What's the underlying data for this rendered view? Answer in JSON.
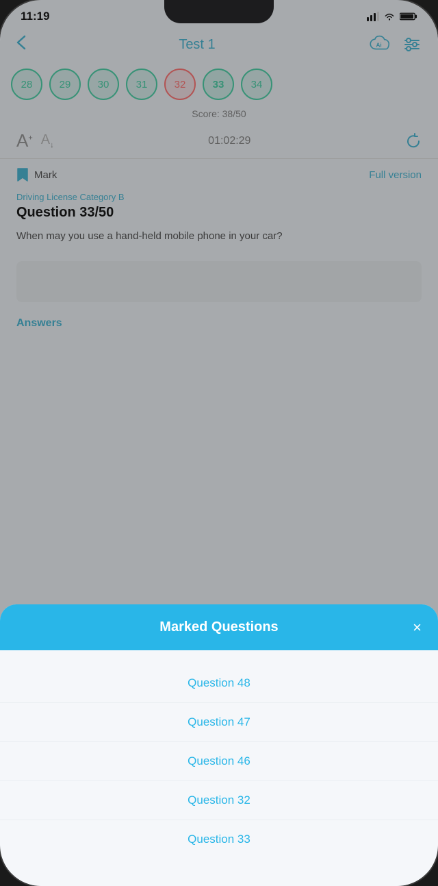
{
  "status_bar": {
    "time": "11:19",
    "signal_label": "signal",
    "wifi_label": "wifi",
    "battery_label": "battery"
  },
  "nav": {
    "back_label": "←",
    "title": "Test 1",
    "cloud_icon": "cloud-icon",
    "settings_icon": "settings-icon"
  },
  "question_numbers": [
    {
      "num": "28",
      "state": "correct"
    },
    {
      "num": "29",
      "state": "correct"
    },
    {
      "num": "30",
      "state": "correct"
    },
    {
      "num": "31",
      "state": "correct"
    },
    {
      "num": "32",
      "state": "wrong"
    },
    {
      "num": "33",
      "state": "active"
    },
    {
      "num": "34",
      "state": "correct"
    }
  ],
  "score": "Score: 38/50",
  "font_controls": {
    "large_a": "A",
    "small_a": "A"
  },
  "timer": "01:02:29",
  "mark": {
    "label": "Mark",
    "full_version": "Full version"
  },
  "question": {
    "category": "Driving License Category B",
    "number_label": "Question 33/50",
    "text": "When may you use a hand-held mobile phone in your car?"
  },
  "answers_label": "Answers",
  "modal": {
    "title": "Marked Questions",
    "close_label": "×",
    "items": [
      {
        "label": "Question 48"
      },
      {
        "label": "Question 47"
      },
      {
        "label": "Question 46"
      },
      {
        "label": "Question 32"
      },
      {
        "label": "Question 33"
      }
    ]
  }
}
